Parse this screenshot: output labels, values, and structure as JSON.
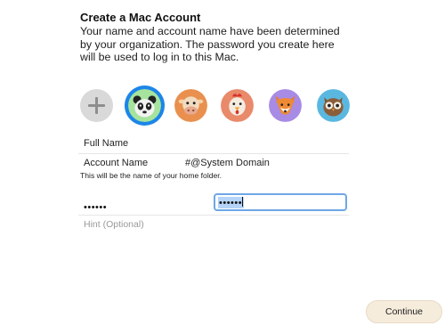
{
  "header": {
    "title": "Create a Mac Account",
    "description": "Your name and account name have been determined by your organization. The password you create here will be used to log in to this Mac."
  },
  "avatars": {
    "items": [
      {
        "name": "add",
        "icon": "plus-icon"
      },
      {
        "name": "panda",
        "icon": "panda-icon",
        "selected": true
      },
      {
        "name": "cow",
        "icon": "cow-icon"
      },
      {
        "name": "chicken",
        "icon": "chicken-icon"
      },
      {
        "name": "fox",
        "icon": "fox-icon"
      },
      {
        "name": "owl",
        "icon": "owl-icon"
      }
    ],
    "selected_ring_color": "#1c86e8"
  },
  "form": {
    "full_name_label": "Full Name",
    "account_name_label": "Account Name",
    "account_name_value": "#@System Domain",
    "home_folder_hint": "This will be the name of your home folder.",
    "password_value": "••••••",
    "verify_value": "••••••",
    "hint_placeholder": "Hint (Optional)"
  },
  "footer": {
    "continue_label": "Continue"
  }
}
